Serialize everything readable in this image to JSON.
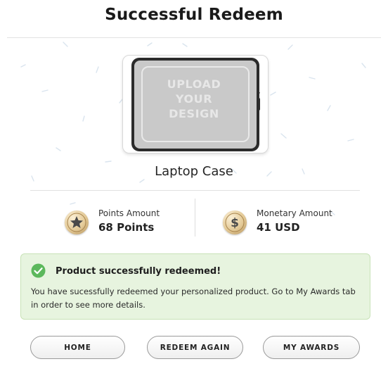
{
  "header": {
    "title": "Successful Redeem"
  },
  "product": {
    "image_text": [
      "UPLOAD",
      "YOUR",
      "DESIGN"
    ],
    "name": "Laptop Case"
  },
  "stats": {
    "points": {
      "icon": "star-coin-icon",
      "label": "Points Amount",
      "value": "68 Points"
    },
    "monetary": {
      "icon": "dollar-coin-icon",
      "label": "Monetary Amount",
      "value": "41 USD"
    }
  },
  "alert": {
    "icon": "check-circle-icon",
    "title": "Product successfully redeemed!",
    "message": "You have sucessfully redeemed your personalized product. Go to My Awards tab in order to see more details.",
    "color_bg": "#e7f4df",
    "color_check": "#5cb85c"
  },
  "buttons": {
    "home": "HOME",
    "redeem_again": "REDEEM AGAIN",
    "my_awards": "MY AWARDS"
  }
}
